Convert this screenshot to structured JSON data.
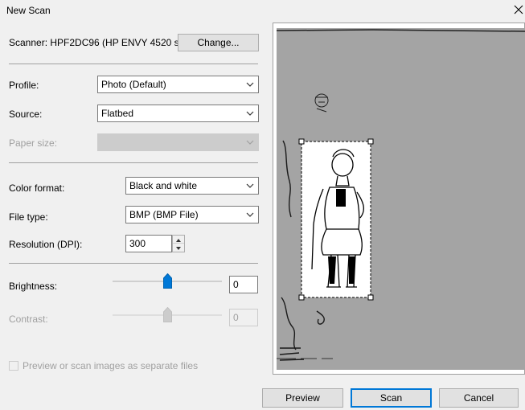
{
  "window": {
    "title": "New Scan"
  },
  "scanner": {
    "label": "Scanner: HPF2DC96 (HP ENVY 4520 s...",
    "change_button": "Change..."
  },
  "fields": {
    "profile": {
      "label": "Profile:",
      "value": "Photo (Default)"
    },
    "source": {
      "label": "Source:",
      "value": "Flatbed"
    },
    "paper_size": {
      "label": "Paper size:",
      "value": ""
    },
    "color_format": {
      "label": "Color format:",
      "value": "Black and white"
    },
    "file_type": {
      "label": "File type:",
      "value": "BMP (BMP File)"
    },
    "resolution": {
      "label": "Resolution (DPI):",
      "value": "300"
    },
    "brightness": {
      "label": "Brightness:",
      "value": "0",
      "level": 0.5
    },
    "contrast": {
      "label": "Contrast:",
      "value": "0",
      "level": 0.5
    }
  },
  "separate_files": {
    "label": "Preview or scan images as separate files",
    "checked": false
  },
  "buttons": {
    "preview": "Preview",
    "scan": "Scan",
    "cancel": "Cancel"
  },
  "colors": {
    "accent": "#0078d7",
    "preview_bg": "#a4a4a4",
    "dialog_bg": "#f0f0f0"
  }
}
